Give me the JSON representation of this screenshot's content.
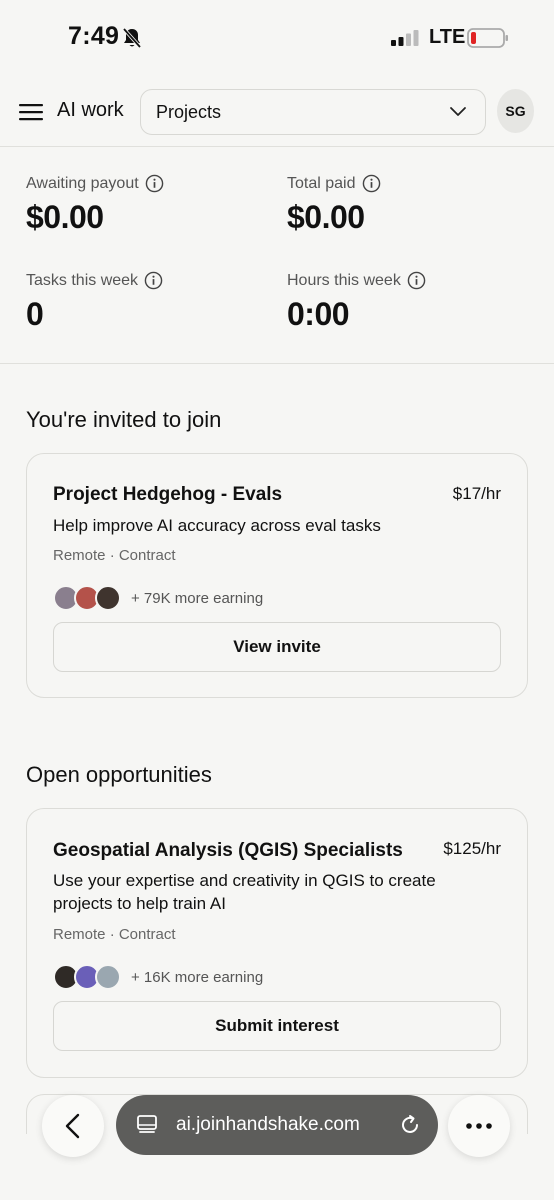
{
  "status_bar": {
    "time": "7:49",
    "network": "LTE",
    "icons": [
      "bell-slash-icon",
      "signal-icon",
      "battery-low-icon"
    ],
    "battery_color": "#e02424"
  },
  "header": {
    "title": "AI work",
    "project_select": {
      "selected": "Projects"
    },
    "avatar_initials": "SG"
  },
  "stats": [
    {
      "label": "Awaiting payout",
      "value": "$0.00"
    },
    {
      "label": "Total paid",
      "value": "$0.00"
    },
    {
      "label": "Tasks this week",
      "value": "0"
    },
    {
      "label": "Hours this week",
      "value": "0:00"
    }
  ],
  "invited": {
    "section_title": "You're invited to join",
    "card": {
      "title": "Project Hedgehog - Evals",
      "rate": "$17/hr",
      "description": "Help improve AI accuracy across eval tasks",
      "meta": "Remote · Contract",
      "earning": "+ 79K more earning",
      "button": "View invite"
    }
  },
  "opportunities": {
    "section_title": "Open opportunities",
    "cards": [
      {
        "title": "Geospatial Analysis (QGIS) Specialists",
        "rate": "$125/hr",
        "description": "Use your expertise and creativity in QGIS to create projects to help train AI",
        "meta": "Remote · Contract",
        "earning": "+ 16K more earning",
        "button": "Submit interest"
      }
    ]
  },
  "browser": {
    "url": "ai.joinhandshake.com"
  },
  "colors": {
    "background": "#f6f6f4",
    "url_pill": "#5d5d5b"
  }
}
